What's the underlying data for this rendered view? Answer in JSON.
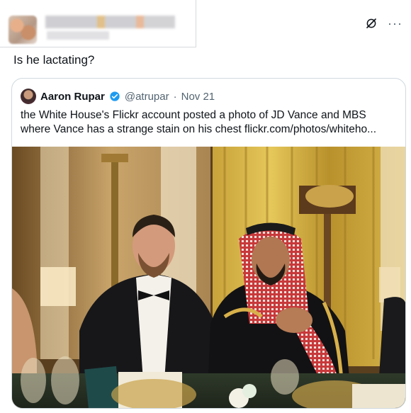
{
  "tweet": {
    "text": "Is he lactating?",
    "icons": [
      "grok-icon",
      "more-icon"
    ]
  },
  "quote": {
    "author_name": "Aaron Rupar",
    "author_handle": "@atrupar",
    "separator": "·",
    "date": "Nov 21",
    "text": "the White House's Flickr account posted a photo of JD Vance and MBS where Vance has a strange stain on his chest flickr.com/photos/whiteho...",
    "verified_color": "#1d9bf0"
  },
  "colors": {
    "text_primary": "#0f1419",
    "text_secondary": "#536471",
    "border": "#cfd9de"
  }
}
